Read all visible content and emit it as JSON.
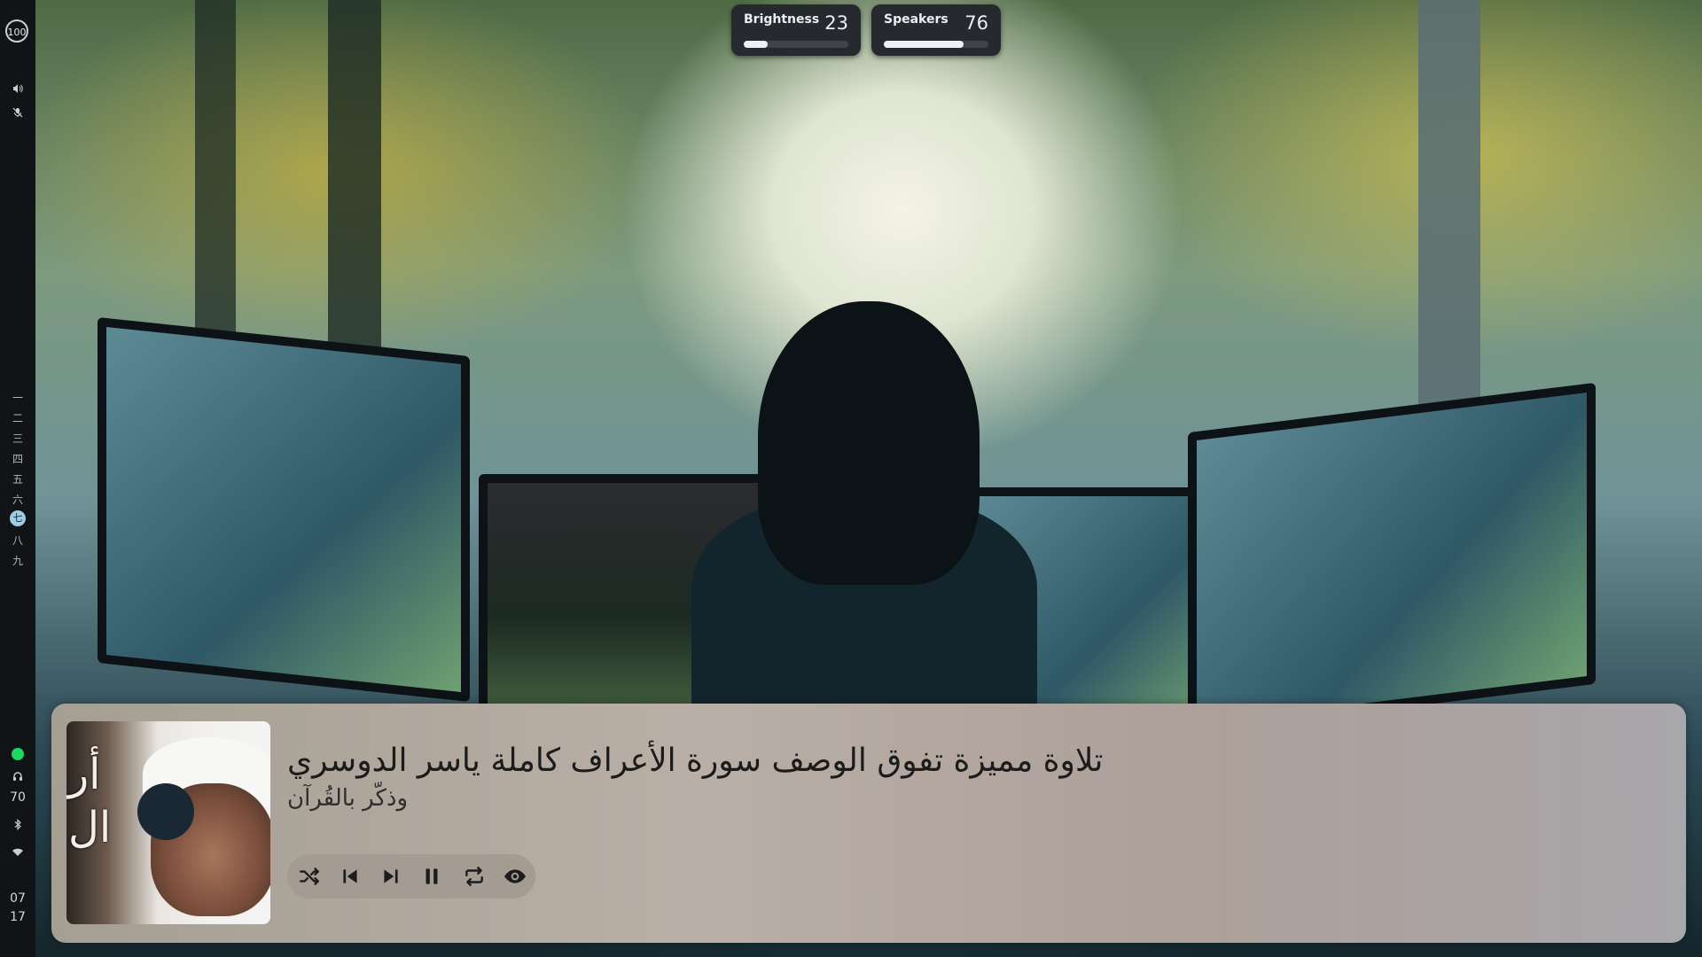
{
  "sidebar": {
    "battery": "100",
    "workspaces": [
      "一",
      "二",
      "三",
      "四",
      "五",
      "六",
      "七",
      "八",
      "九"
    ],
    "active_workspace": "七",
    "volume_level": "70",
    "clock": {
      "hour": "07",
      "minute": "17"
    },
    "icons": [
      "volume-icon",
      "mic-muted-icon",
      "spotify-icon",
      "headphones-icon",
      "bluetooth-icon",
      "wifi-icon"
    ]
  },
  "osd": {
    "brightness": {
      "label": "Brightness",
      "value": "23",
      "level": 0.23
    },
    "speakers": {
      "label": "Speakers",
      "value": "76",
      "level": 0.76
    }
  },
  "player": {
    "title": "تلاوة مميزة تفوق الوصف سورة الأعراف كاملة ياسر الدوسري",
    "artist": "وذكّر بالقُرآن",
    "controls": [
      "shuffle-icon",
      "previous-icon",
      "next-icon",
      "pause-icon",
      "repeat-icon",
      "eye-icon"
    ]
  }
}
